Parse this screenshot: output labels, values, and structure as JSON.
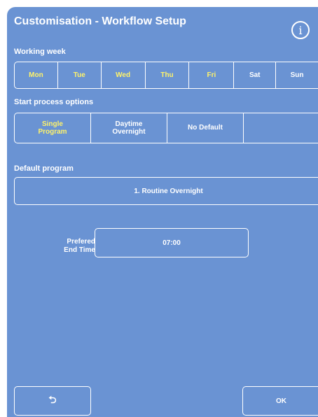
{
  "header": {
    "title": "Customisation - Workflow Setup",
    "info_icon": "info-circle-icon",
    "info_glyph": "i"
  },
  "working_week": {
    "label": "Working week",
    "days": [
      {
        "label": "Mon",
        "selected": true
      },
      {
        "label": "Tue",
        "selected": true
      },
      {
        "label": "Wed",
        "selected": true
      },
      {
        "label": "Thu",
        "selected": true
      },
      {
        "label": "Fri",
        "selected": true
      },
      {
        "label": "Sat",
        "selected": false
      },
      {
        "label": "Sun",
        "selected": false
      }
    ]
  },
  "start_process": {
    "label": "Start process options",
    "options": [
      {
        "line1": "Single",
        "line2": "Program",
        "selected": true
      },
      {
        "line1": "Daytime",
        "line2": "Overnight",
        "selected": false
      },
      {
        "line1": "No Default",
        "line2": "",
        "selected": false
      },
      {
        "line1": "",
        "line2": "",
        "selected": false
      }
    ]
  },
  "default_program": {
    "label": "Default program",
    "value": "1. Routine Overnight"
  },
  "end_time": {
    "label_line1": "Prefered",
    "label_line2": "End Time",
    "value": "07:00"
  },
  "footer": {
    "back_icon": "return-arrow-icon",
    "back_glyph": "⮌",
    "ok_label": "OK"
  },
  "colors": {
    "background": "#6a93d3",
    "selected_text": "#fff36a",
    "normal_text": "#ffffff"
  }
}
